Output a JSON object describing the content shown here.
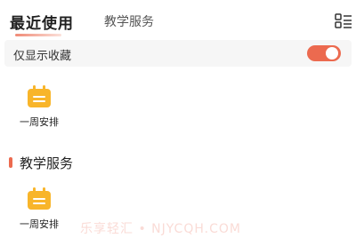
{
  "tabs": {
    "active": "最近使用",
    "inactive": "教学服务"
  },
  "filter": {
    "label": "仅显示收藏",
    "toggle_on": true
  },
  "recent_apps": [
    {
      "label": "一周安排",
      "icon": "calendar-icon"
    }
  ],
  "section": {
    "title": "教学服务",
    "apps": [
      {
        "label": "一周安排",
        "icon": "calendar-icon"
      }
    ]
  },
  "watermark": "乐享轻汇 • NJYCQH.COM",
  "colors": {
    "accent": "#ec6a4f",
    "icon_yellow": "#f8b52a",
    "filter_bg": "#f6f6f6"
  }
}
